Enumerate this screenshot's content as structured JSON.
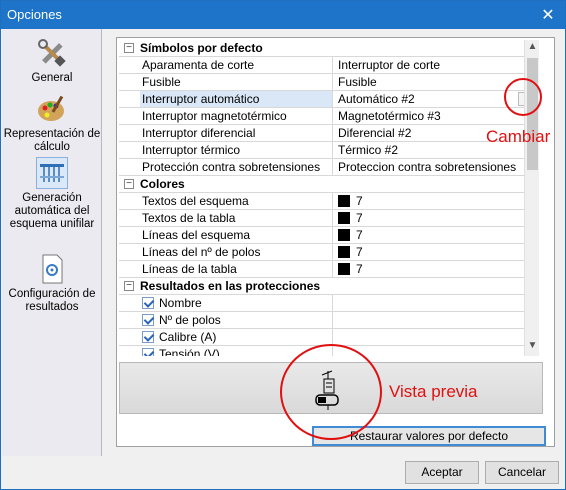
{
  "window": {
    "title": "Opciones",
    "close_glyph": "✕"
  },
  "sidebar": {
    "items": [
      {
        "label": "General",
        "icon": "tools-icon"
      },
      {
        "label": "Representación de cálculo",
        "icon": "palette-icon"
      },
      {
        "label": "Generación automática del esquema unifilar",
        "icon": "schema-icon",
        "selected": true
      },
      {
        "label": "Configuración de resultados",
        "icon": "settings-doc-icon"
      }
    ]
  },
  "grid": {
    "categories": [
      {
        "title": "Símbolos por defecto",
        "rows": [
          {
            "name": "Aparamenta de corte",
            "value": "Interruptor de corte"
          },
          {
            "name": "Fusible",
            "value": "Fusible"
          },
          {
            "name": "Interruptor automático",
            "value": "Automático #2",
            "button": "...",
            "selected": true
          },
          {
            "name": "Interruptor magnetotérmico",
            "value": "Magnetotérmico #3"
          },
          {
            "name": "Interruptor diferencial",
            "value": "Diferencial #2"
          },
          {
            "name": "Interruptor térmico",
            "value": "Térmico #2"
          },
          {
            "name": "Protección contra sobretensiones",
            "value": "Proteccion contra sobretensiones"
          }
        ]
      },
      {
        "title": "Colores",
        "rows": [
          {
            "name": "Textos del esquema",
            "value": "7",
            "color": "#000000"
          },
          {
            "name": "Textos de la tabla",
            "value": "7",
            "color": "#000000"
          },
          {
            "name": "Líneas del esquema",
            "value": "7",
            "color": "#000000"
          },
          {
            "name": "Líneas del nº de polos",
            "value": "7",
            "color": "#000000"
          },
          {
            "name": "Líneas de la tabla",
            "value": "7",
            "color": "#000000"
          }
        ]
      },
      {
        "title": "Resultados en las protecciones",
        "rows": [
          {
            "name": "Nombre",
            "checked": true
          },
          {
            "name": "Nº de polos",
            "checked": true
          },
          {
            "name": "Calibre (A)",
            "checked": true
          },
          {
            "name": "Tensión (V)",
            "checked": true
          }
        ]
      }
    ],
    "toggle_glyph": "−"
  },
  "restore_label": "Restaurar valores por defecto",
  "footer": {
    "accept_label": "Aceptar",
    "cancel_label": "Cancelar"
  },
  "annotations": {
    "change": "Cambiar",
    "preview": "Vista previa",
    "color": "#e01010"
  }
}
